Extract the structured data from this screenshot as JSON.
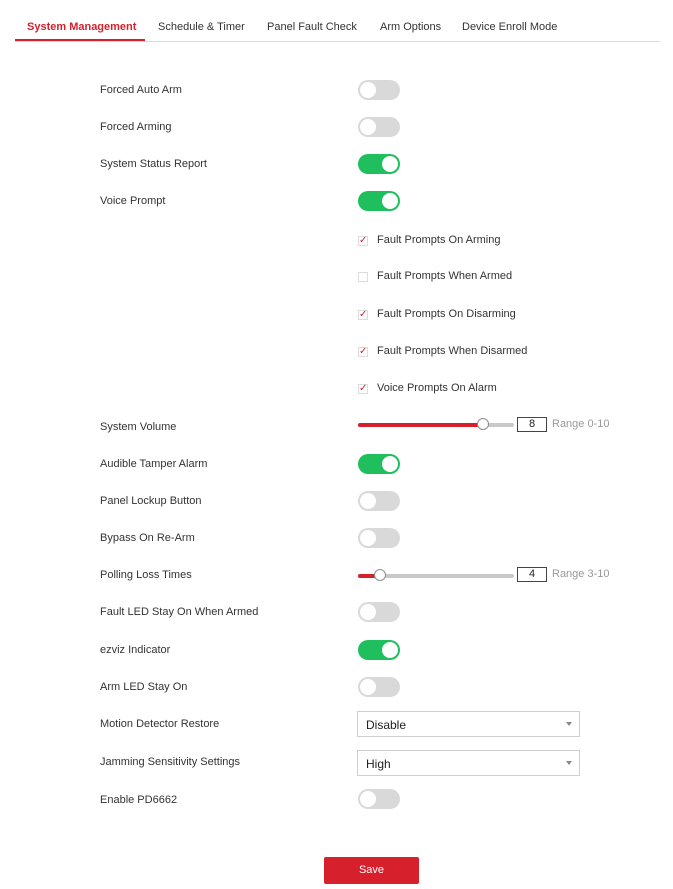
{
  "tabs": [
    {
      "label": "System Management",
      "active": true
    },
    {
      "label": "Schedule & Timer",
      "active": false
    },
    {
      "label": "Panel Fault Check",
      "active": false
    },
    {
      "label": "Arm Options",
      "active": false
    },
    {
      "label": "Device Enroll Mode",
      "active": false
    }
  ],
  "settings": {
    "forced_auto_arm": {
      "label": "Forced Auto Arm",
      "enabled": false
    },
    "forced_arming": {
      "label": "Forced Arming",
      "enabled": false
    },
    "system_status_report": {
      "label": "System Status Report",
      "enabled": true
    },
    "voice_prompt": {
      "label": "Voice Prompt",
      "enabled": true
    },
    "voice_options": [
      {
        "label": "Fault Prompts On Arming",
        "checked": true
      },
      {
        "label": "Fault Prompts When Armed",
        "checked": false
      },
      {
        "label": "Fault Prompts On Disarming",
        "checked": true
      },
      {
        "label": "Fault Prompts When Disarmed",
        "checked": true
      },
      {
        "label": "Voice Prompts On Alarm",
        "checked": true
      }
    ],
    "system_volume": {
      "label": "System Volume",
      "value": "8",
      "range_text": "Range 0-10",
      "fraction": 0.8
    },
    "audible_tamper_alarm": {
      "label": "Audible Tamper Alarm",
      "enabled": true
    },
    "panel_lockup_button": {
      "label": "Panel Lockup Button",
      "enabled": false
    },
    "bypass_on_rearm": {
      "label": "Bypass On Re-Arm",
      "enabled": false
    },
    "polling_loss_times": {
      "label": "Polling Loss Times",
      "value": "4",
      "range_text": "Range 3-10",
      "fraction": 0.143
    },
    "fault_led_stay_on": {
      "label": "Fault LED Stay On When Armed",
      "enabled": false
    },
    "ezviz_indicator": {
      "label": "ezviz Indicator",
      "enabled": true
    },
    "arm_led_stay_on": {
      "label": "Arm LED Stay On",
      "enabled": false
    },
    "motion_detector_restore": {
      "label": "Motion Detector Restore",
      "value": "Disable"
    },
    "jamming_sensitivity": {
      "label": "Jamming Sensitivity Settings",
      "value": "High"
    },
    "enable_pd6662": {
      "label": "Enable PD6662",
      "enabled": false
    }
  },
  "actions": {
    "save_label": "Save"
  },
  "colors": {
    "accent": "#d6202c",
    "toggle_on": "#1fbf5e",
    "toggle_off": "#d9d9d9"
  }
}
